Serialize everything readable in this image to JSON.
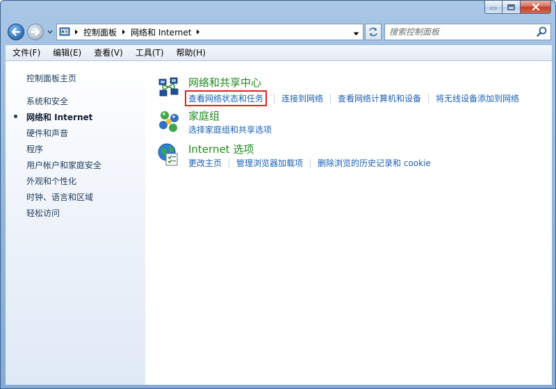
{
  "window": {
    "caption": {
      "min_icon": "minimize-icon",
      "max_icon": "maximize-icon",
      "close_icon": "close-icon"
    }
  },
  "address": {
    "crumbs": [
      "控制面板",
      "网络和 Internet"
    ]
  },
  "search": {
    "placeholder": "搜索控制面板"
  },
  "menu": [
    "文件(F)",
    "编辑(E)",
    "查看(V)",
    "工具(T)",
    "帮助(H)"
  ],
  "sidebar": {
    "home": "控制面板主页",
    "items": [
      "系统和安全",
      "网络和 Internet",
      "硬件和声音",
      "程序",
      "用户帐户和家庭安全",
      "外观和个性化",
      "时钟、语言和区域",
      "轻松访问"
    ],
    "active_index": 1
  },
  "categories": [
    {
      "title": "网络和共享中心",
      "icon": "network-sharing-icon",
      "links": [
        "查看网络状态和任务",
        "连接到网络",
        "查看网络计算机和设备",
        "将无线设备添加到网络"
      ],
      "highlighted_link_index": 0
    },
    {
      "title": "家庭组",
      "icon": "homegroup-icon",
      "links": [
        "选择家庭组和共享选项"
      ]
    },
    {
      "title": "Internet 选项",
      "icon": "internet-options-icon",
      "links": [
        "更改主页",
        "管理浏览器加载项",
        "删除浏览的历史记录和 cookie"
      ]
    }
  ],
  "colors": {
    "category_title": "#1f8a1f",
    "task_link": "#1a5fb4",
    "highlight": "#e0211e",
    "sidebar_link": "#1e395b"
  }
}
